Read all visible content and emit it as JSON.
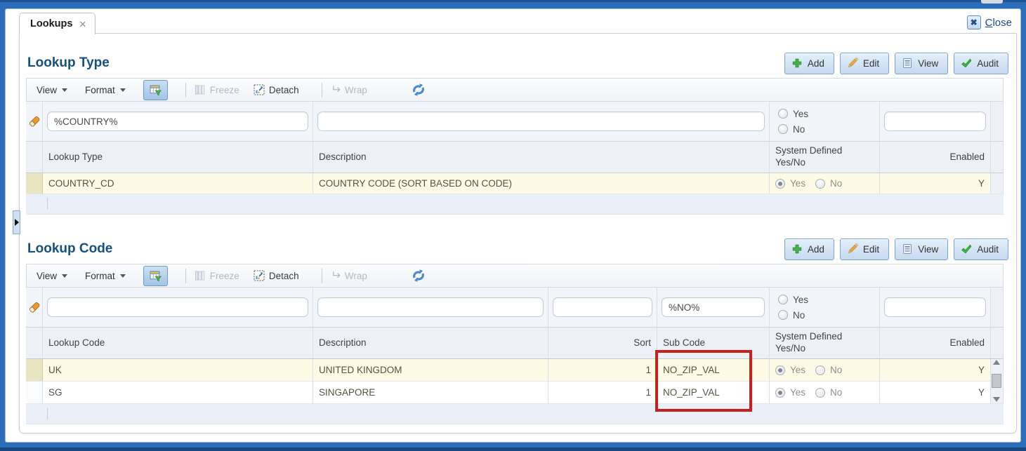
{
  "tab": {
    "title": "Lookups",
    "close_glyph": "✕"
  },
  "window": {
    "close_initial": "C",
    "close_rest": "lose",
    "close_icon_glyph": "✖"
  },
  "toolbar": {
    "view": "View",
    "format": "Format",
    "freeze": "Freeze",
    "detach": "Detach",
    "wrap": "Wrap",
    "wrap_glyph": "↵"
  },
  "radio_labels": {
    "yes": "Yes",
    "no": "No"
  },
  "colors": {
    "frame_blue": "#2b6db8",
    "accent_blue": "#1a4c94",
    "section_title": "#15517c",
    "selected_row": "#fdfae6",
    "highlight_red": "#c9201b"
  },
  "sections": {
    "lookup_type": {
      "title": "Lookup Type",
      "actions": {
        "add": "Add",
        "edit": "Edit",
        "view": "View",
        "audit": "Audit"
      },
      "filters": {
        "lookup_type": "%COUNTRY%",
        "description": "",
        "enabled": ""
      },
      "columns": {
        "lookup_type": "Lookup Type",
        "description": "Description",
        "system_defined": "System Defined Yes/No",
        "enabled": "Enabled"
      },
      "rows": [
        {
          "lookup_type": "COUNTRY_CD",
          "description": "COUNTRY CODE (SORT BASED ON CODE)",
          "system_defined": "Yes",
          "enabled": "Y"
        }
      ]
    },
    "lookup_code": {
      "title": "Lookup Code",
      "actions": {
        "add": "Add",
        "edit": "Edit",
        "view": "View",
        "audit": "Audit"
      },
      "filters": {
        "lookup_code": "",
        "description": "",
        "sort": "",
        "sub_code": "%NO%",
        "enabled": ""
      },
      "columns": {
        "lookup_code": "Lookup Code",
        "description": "Description",
        "sort": "Sort",
        "sub_code": "Sub Code",
        "system_defined": "System Defined Yes/No",
        "enabled": "Enabled"
      },
      "rows": [
        {
          "lookup_code": "UK",
          "description": "UNITED KINGDOM",
          "sort": "1",
          "sub_code": "NO_ZIP_VAL",
          "system_defined": "Yes",
          "enabled": "Y"
        },
        {
          "lookup_code": "SG",
          "description": "SINGAPORE",
          "sort": "1",
          "sub_code": "NO_ZIP_VAL",
          "system_defined": "Yes",
          "enabled": "Y"
        }
      ]
    }
  }
}
